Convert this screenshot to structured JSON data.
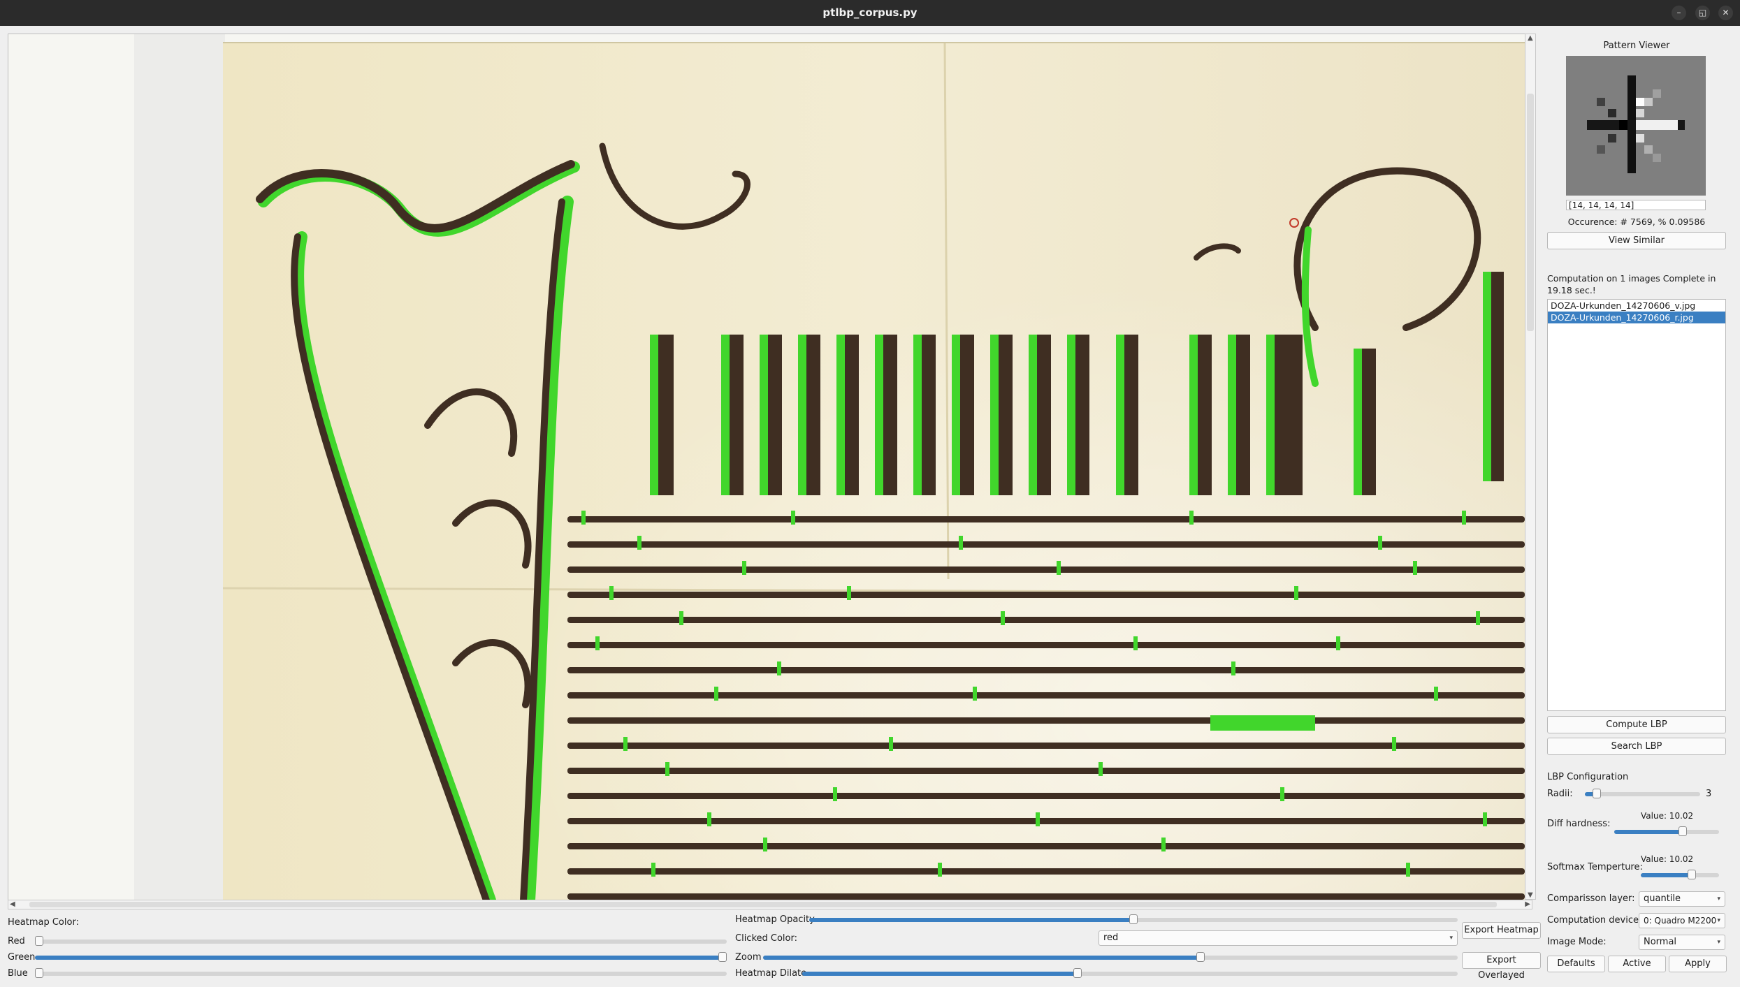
{
  "window": {
    "title": "ptlbp_corpus.py",
    "minimize_icon": "–",
    "restore_icon": "◱",
    "close_icon": "✕"
  },
  "pattern_viewer": {
    "title": "Pattern Viewer",
    "pattern_value": "[14, 14, 14, 14]",
    "occurrence": "Occurence: # 7569,  % 0.09586",
    "view_similar": "View Similar"
  },
  "computation_status": "Computation on 1 images Complete in 19.18 sec.!",
  "files": [
    {
      "name": "DOZA-Urkunden_14270606_v.jpg",
      "selected": false
    },
    {
      "name": "DOZA-Urkunden_14270606_r.jpg",
      "selected": true
    }
  ],
  "buttons": {
    "compute_lbp": "Compute LBP",
    "search_lbp": "Search LBP",
    "export_heatmap": "Export Heatmap",
    "export_overlayed": "Export Overlayed",
    "defaults": "Defaults",
    "active": "Active",
    "apply": "Apply"
  },
  "lbp_config": {
    "title": "LBP Configuration",
    "radii_label": "Radii:",
    "radii_value": "3",
    "radii_fraction": 0.1,
    "diff_hardness_label": "Diff hardness:",
    "diff_hardness_value": "Value: 10.02",
    "diff_hardness_fraction": 0.65,
    "softmax_label": "Softmax Temperture:",
    "softmax_value": "Value: 10.02",
    "softmax_fraction": 0.65,
    "comparison_layer_label": "Comparisson layer:",
    "comparison_layer_value": "quantile",
    "device_label": "Computation device",
    "device_value": "0: Quadro M2200",
    "image_mode_label": "Image Mode:",
    "image_mode_value": "Normal"
  },
  "heatmap": {
    "color_label": "Heatmap Color:",
    "red_label": "Red",
    "red_fraction": 0.0,
    "green_label": "Green",
    "green_fraction": 1.0,
    "blue_label": "Blue",
    "blue_fraction": 0.0,
    "opacity_label": "Heatmap Opacity",
    "opacity_fraction": 0.5,
    "clicked_color_label": "Clicked Color:",
    "clicked_color_value": "red",
    "zoom_label": "Zoom",
    "zoom_fraction": 0.63,
    "dilate_label": "Heatmap Dilate",
    "dilate_fraction": 0.42
  },
  "colors": {
    "accent": "#3a7fc2",
    "heatmap": "#3ed42a",
    "ink": "#3e2f25",
    "parchment": "#f2ecd2"
  },
  "icons": {
    "chevron": "▾",
    "scroll_up": "▲",
    "scroll_down": "▼",
    "scroll_left": "◀",
    "scroll_right": "▶"
  }
}
